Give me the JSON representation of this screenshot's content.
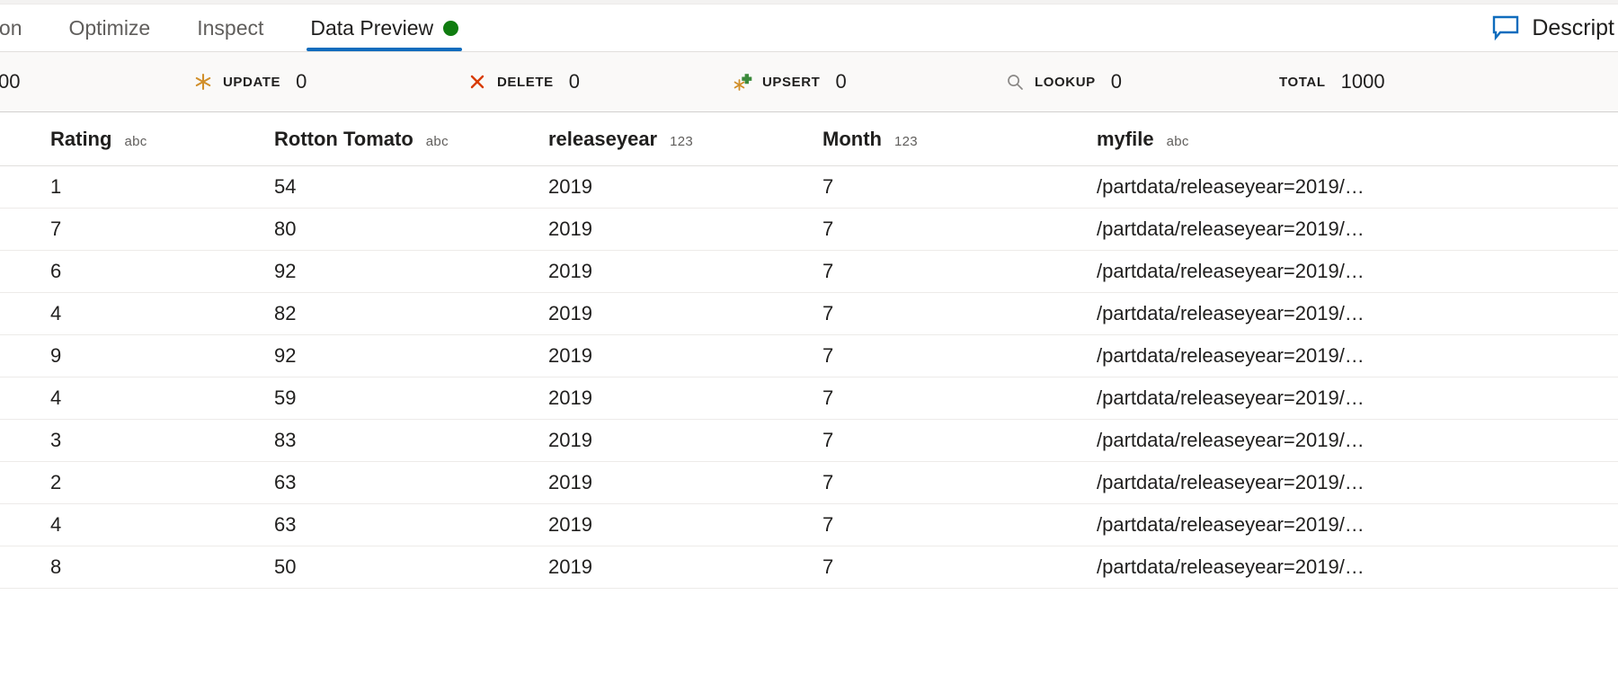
{
  "tabs": [
    {
      "label": "jection",
      "active": false,
      "truncated_left": true
    },
    {
      "label": "Optimize",
      "active": false
    },
    {
      "label": "Inspect",
      "active": false
    },
    {
      "label": "Data Preview",
      "active": true,
      "dot": "green-status-dot"
    }
  ],
  "description_button": {
    "label": "Descript",
    "icon": "comment-icon",
    "icon_color": "#0f6cbd"
  },
  "stats": [
    {
      "label": "",
      "value": "00",
      "icon": "none",
      "icon_color": ""
    },
    {
      "label": "UPDATE",
      "value": "0",
      "icon": "asterisk-icon",
      "icon_color": "#d18f2a"
    },
    {
      "label": "DELETE",
      "value": "0",
      "icon": "cross-icon",
      "icon_color": "#d83b01"
    },
    {
      "label": "UPSERT",
      "value": "0",
      "icon": "upsert-icon",
      "icon_color": "#d18f2a"
    },
    {
      "label": "LOOKUP",
      "value": "0",
      "icon": "search-icon",
      "icon_color": "#8a8886"
    },
    {
      "label": "TOTAL",
      "value": "1000",
      "icon": "none",
      "icon_color": ""
    }
  ],
  "table": {
    "columns": [
      {
        "name": "Rating",
        "type": "abc"
      },
      {
        "name": "Rotton Tomato",
        "type": "abc"
      },
      {
        "name": "releaseyear",
        "type": "123"
      },
      {
        "name": "Month",
        "type": "123"
      },
      {
        "name": "myfile",
        "type": "abc"
      }
    ],
    "rows": [
      {
        "rating": "1",
        "rotton": "54",
        "releaseyear": "2019",
        "month": "7",
        "myfile": "/partdata/releaseyear=2019/…"
      },
      {
        "rating": "7",
        "rotton": "80",
        "releaseyear": "2019",
        "month": "7",
        "myfile": "/partdata/releaseyear=2019/…"
      },
      {
        "rating": "6",
        "rotton": "92",
        "releaseyear": "2019",
        "month": "7",
        "myfile": "/partdata/releaseyear=2019/…"
      },
      {
        "rating": "4",
        "rotton": "82",
        "releaseyear": "2019",
        "month": "7",
        "myfile": "/partdata/releaseyear=2019/…"
      },
      {
        "rating": "9",
        "rotton": "92",
        "releaseyear": "2019",
        "month": "7",
        "myfile": "/partdata/releaseyear=2019/…"
      },
      {
        "rating": "4",
        "rotton": "59",
        "releaseyear": "2019",
        "month": "7",
        "myfile": "/partdata/releaseyear=2019/…"
      },
      {
        "rating": "3",
        "rotton": "83",
        "releaseyear": "2019",
        "month": "7",
        "myfile": "/partdata/releaseyear=2019/…"
      },
      {
        "rating": "2",
        "rotton": "63",
        "releaseyear": "2019",
        "month": "7",
        "myfile": "/partdata/releaseyear=2019/…"
      },
      {
        "rating": "4",
        "rotton": "63",
        "releaseyear": "2019",
        "month": "7",
        "myfile": "/partdata/releaseyear=2019/…"
      },
      {
        "rating": "8",
        "rotton": "50",
        "releaseyear": "2019",
        "month": "7",
        "myfile": "/partdata/releaseyear=2019/…"
      }
    ]
  },
  "colors": {
    "accent": "#0f6cbd",
    "status_green": "#107c10",
    "delete_red": "#d83b01",
    "update_orange": "#d18f2a",
    "upsert_green": "#3b8a3b",
    "lookup_gray": "#8a8886",
    "statsbar_bg": "#faf9f8",
    "row_border": "#edebe9"
  }
}
